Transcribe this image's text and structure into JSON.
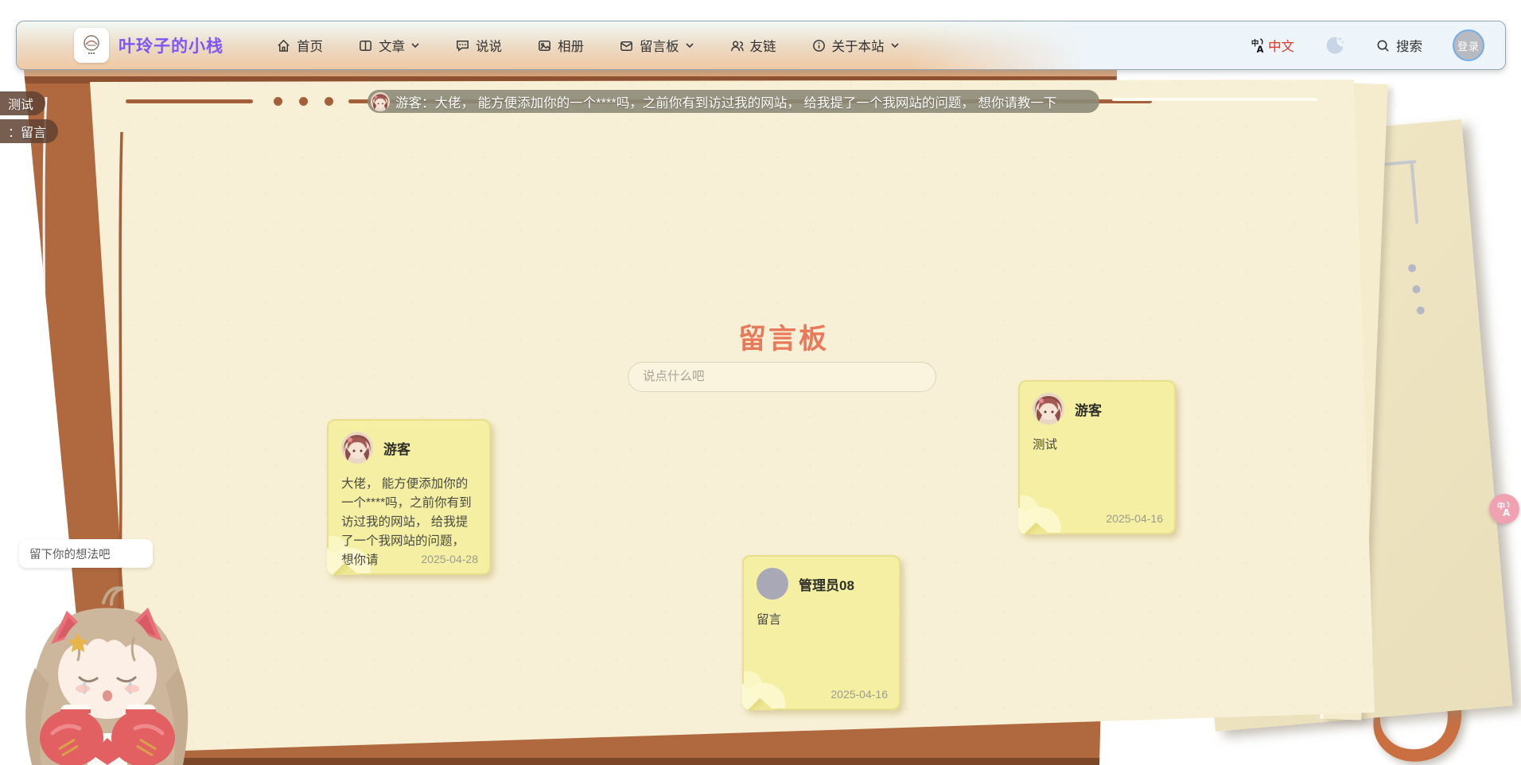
{
  "site": {
    "name": "叶玲子的小栈"
  },
  "nav": {
    "items": [
      {
        "label": "首页",
        "icon": "home-icon",
        "has_dropdown": false
      },
      {
        "label": "文章",
        "icon": "article-icon",
        "has_dropdown": true
      },
      {
        "label": "说说",
        "icon": "talks-icon",
        "has_dropdown": false
      },
      {
        "label": "相册",
        "icon": "album-icon",
        "has_dropdown": false
      },
      {
        "label": "留言板",
        "icon": "message-board-icon",
        "has_dropdown": true
      },
      {
        "label": "友链",
        "icon": "friends-icon",
        "has_dropdown": false
      },
      {
        "label": "关于本站",
        "icon": "about-icon",
        "has_dropdown": true
      }
    ],
    "language": "中文",
    "search_label": "搜索",
    "login_label": "登录"
  },
  "announcement": {
    "text": "游客：大佬， 能方便添加你的一个****吗，之前你有到访过我的网站， 给我提了一个我网站的问题， 想你请教一下"
  },
  "toasts": [
    {
      "text": "测试"
    },
    {
      "text": "：留言"
    }
  ],
  "board": {
    "title": "留言板",
    "input_placeholder": "说点什么吧"
  },
  "notes": [
    {
      "name": "游客",
      "text": "大佬， 能方便添加你的一个****吗，之前你有到访过我的网站， 给我提了一个我网站的问题， 想你请",
      "date": "2025-04-28",
      "avatar": "anime-girl"
    },
    {
      "name": "游客",
      "text": "测试",
      "date": "2025-04-16",
      "avatar": "anime-girl"
    },
    {
      "name": "管理员08",
      "text": "留言",
      "date": "2025-04-16",
      "avatar": "gray-circle"
    }
  ],
  "mascot": {
    "bubble_text": "留下你的想法吧"
  },
  "colors": {
    "cover_sienna": "#b0693f",
    "page_cream": "#f8f0d6",
    "note_yellow": "#f4efa2",
    "title_coral": "#e8795a",
    "brand_purple": "#7e57f2",
    "language_red": "#e0392a",
    "login_ring_blue": "#74aeea",
    "float_button_pink": "#f0a2b2",
    "marquee_gray": "#8c8a78"
  }
}
